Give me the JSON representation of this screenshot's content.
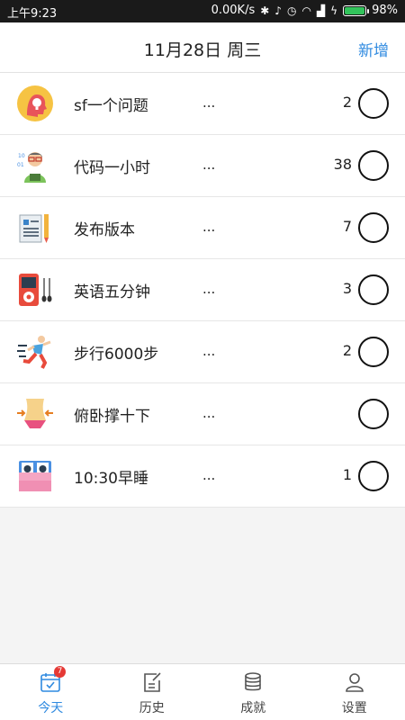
{
  "status_bar": {
    "time": "上午9:23",
    "speed": "0.00K/s",
    "battery_text": "98%",
    "battery_level": 0.98,
    "battery_color": "#32c35b"
  },
  "header": {
    "title": "11月28日 周三",
    "add_label": "新增"
  },
  "tasks": [
    {
      "name": "sf一个问题",
      "dots": "...",
      "count": "2",
      "icon": "lightbulb-head-icon"
    },
    {
      "name": "代码一小时",
      "dots": "...",
      "count": "38",
      "icon": "programmer-icon"
    },
    {
      "name": "发布版本",
      "dots": "...",
      "count": "7",
      "icon": "document-pencil-icon"
    },
    {
      "name": "英语五分钟",
      "dots": "...",
      "count": "3",
      "icon": "music-player-icon"
    },
    {
      "name": "步行6000步",
      "dots": "...",
      "count": "2",
      "icon": "runner-icon"
    },
    {
      "name": "俯卧撑十下",
      "dots": "...",
      "count": "",
      "icon": "waist-icon"
    },
    {
      "name": "10:30早睡",
      "dots": "...",
      "count": "1",
      "icon": "bed-icon"
    }
  ],
  "tabs": [
    {
      "label": "今天",
      "icon": "calendar-check-icon",
      "active": true,
      "badge": "7"
    },
    {
      "label": "历史",
      "icon": "edit-note-icon"
    },
    {
      "label": "成就",
      "icon": "coins-stack-icon"
    },
    {
      "label": "设置",
      "icon": "person-icon"
    }
  ],
  "colors": {
    "accent": "#2f8ae0",
    "badge": "#e53935"
  }
}
